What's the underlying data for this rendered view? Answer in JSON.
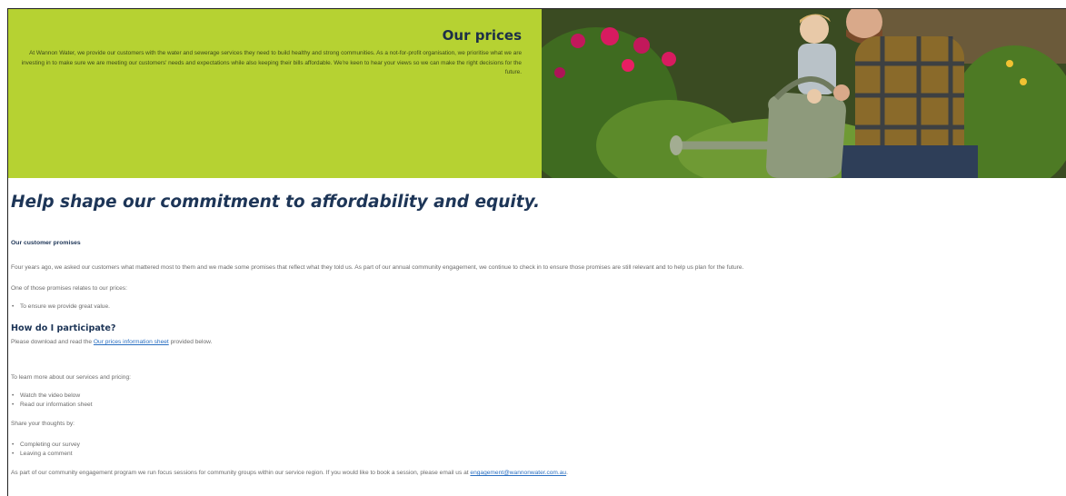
{
  "hero": {
    "title": "Our prices",
    "text": "At Wannon Water, we provide our customers with the water and sewerage services they need to build healthy and strong communities. As a not-for-profit organisation, we prioritise what we are investing in to make sure we are meeting our customers' needs and expectations while also keeping their bills affordable. We're keen to hear your views so we can make the right decisions for the future.",
    "image_alt": "father-and-child-watering-garden-photo"
  },
  "main": {
    "headline": "Help shape our commitment to affordability and equity.",
    "promises_heading": "Our customer promises",
    "promises_text": "Four years ago, we asked our customers what mattered most to them and we made some promises that reflect what they told us. As part of our annual community engagement, we continue to check in to ensure those promises are still relevant and to help us plan for the future.",
    "promises_intro": "One of those promises relates to our prices:",
    "promises_list": [
      "To ensure we provide great value."
    ],
    "participate_heading": "How do I participate?",
    "participate_prefix": "Please download and read the ",
    "participate_link": "Our prices information sheet",
    "participate_suffix": " provided below.",
    "learn_intro": "To learn more about our services and pricing:",
    "learn_list": [
      "Watch the video below",
      "Read our information sheet"
    ],
    "share_intro": "Share your thoughts by:",
    "share_list": [
      "Completing our survey",
      "Leaving a comment"
    ],
    "focus_prefix": "As part of our community engagement program we run focus sessions for community groups within our service region. If you would like to book a session, please email us at ",
    "focus_email": "engagement@wannonwater.com.au",
    "focus_suffix": "."
  },
  "colors": {
    "hero_green": "#b6d232",
    "heading_navy": "#1d3557",
    "link_blue": "#2a6fc1"
  }
}
